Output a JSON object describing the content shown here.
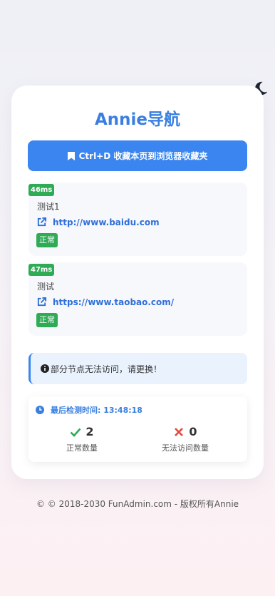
{
  "header": {
    "title": "Annie导航",
    "theme_icon": "moon-icon"
  },
  "bookmark_button": {
    "label": "Ctrl+D 收藏本页到浏览器收藏夹",
    "icon": "bookmark-icon"
  },
  "sites": [
    {
      "latency": "46ms",
      "name": "测试1",
      "url": "http://www.baidu.com",
      "status": "正常"
    },
    {
      "latency": "47ms",
      "name": "测试",
      "url": "https://www.taobao.com/",
      "status": "正常"
    }
  ],
  "alert": {
    "text": "部分节点无法访问，请更换！",
    "icon": "info-circle-icon"
  },
  "stats": {
    "check_time": "最后检测时间: 13:48:18",
    "ok_count": "2",
    "ok_label": "正常数量",
    "bad_count": "0",
    "bad_label": "无法访问数量"
  },
  "footer": {
    "text": "© © 2018-2030 FunAdmin.com - 版权所有Annie"
  },
  "colors": {
    "accent": "#3a85f0",
    "success": "#2faa55",
    "danger": "#e5483b"
  }
}
